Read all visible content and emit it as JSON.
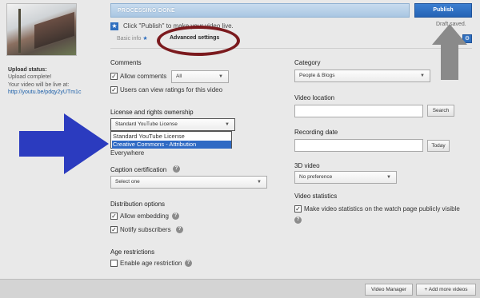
{
  "status": {
    "banner": "PROCESSING DONE",
    "publish_label": "Publish",
    "draft_label": "Draft saved."
  },
  "hint": "Click \"Publish\" to make your video live.",
  "tabs": {
    "basic": "Basic info",
    "basic_icon": "star-icon",
    "advanced": "Advanced settings"
  },
  "upload": {
    "status_label": "Upload status:",
    "status_value": "Upload complete!",
    "live_text": "Your video will be live at:",
    "link": "http://youtu.be/pdqy2yUTm1c"
  },
  "comments": {
    "title": "Comments",
    "allow_label": "Allow comments",
    "allow_checked": true,
    "mode_value": "All",
    "ratings_label": "Users can view ratings for this video",
    "ratings_checked": true
  },
  "license": {
    "title": "License and rights ownership",
    "value": "Standard YouTube License",
    "options": [
      "Standard YouTube License",
      "Creative Commons - Attribution"
    ],
    "selected_index": 1,
    "trailing": "Everywhere"
  },
  "caption": {
    "title": "Caption certification",
    "value": "Select one"
  },
  "distribution": {
    "title": "Distribution options",
    "embed_label": "Allow embedding",
    "embed_checked": true,
    "notify_label": "Notify subscribers",
    "notify_checked": true
  },
  "age": {
    "title": "Age restrictions",
    "enable_label": "Enable age restriction",
    "checked": false
  },
  "category": {
    "title": "Category",
    "value": "People & Blogs"
  },
  "location": {
    "title": "Video location",
    "search_label": "Search"
  },
  "recording": {
    "title": "Recording date",
    "today_label": "Today"
  },
  "video3d": {
    "title": "3D video",
    "value": "No preference"
  },
  "stats": {
    "title": "Video statistics",
    "label": "Make video statistics on the watch page publicly visible",
    "checked": true
  },
  "footer": {
    "video_manager": "Video Manager",
    "add_more": "+ Add more videos"
  },
  "colors": {
    "accent": "#2563b5",
    "annotation_arrow": "#2b3bbf",
    "annotation_oval": "#7b1a1e",
    "gray_arrow": "#8a8a8a"
  }
}
